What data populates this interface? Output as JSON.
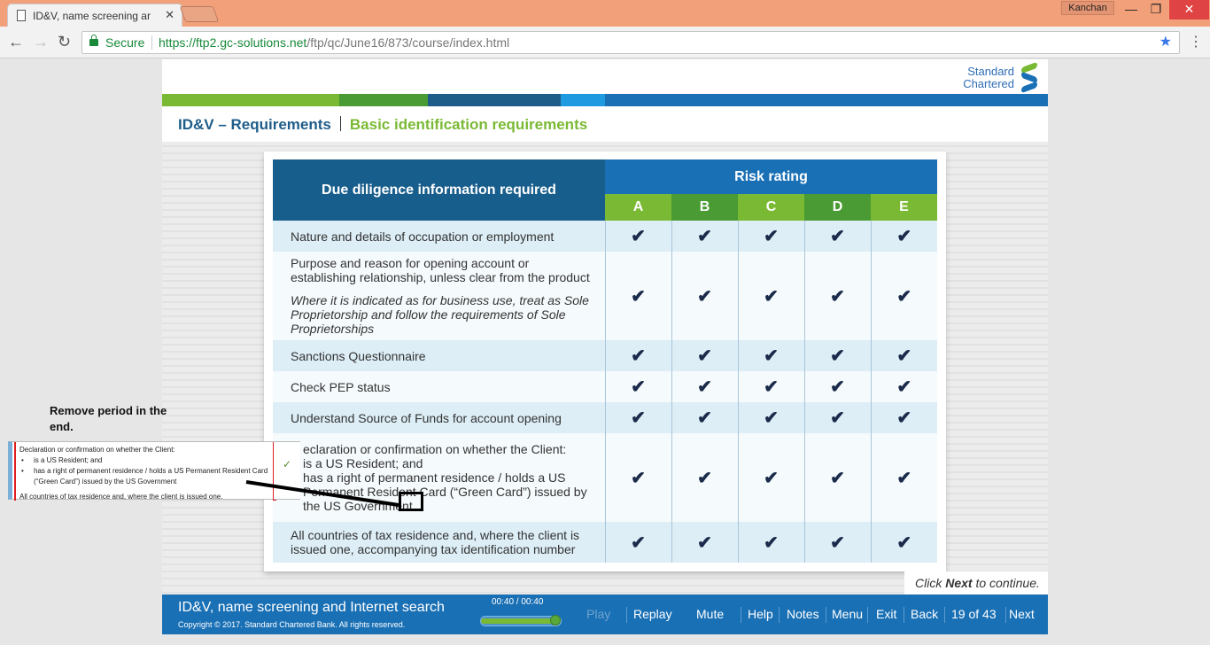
{
  "browser": {
    "tab_title": "ID&V, name screening ar",
    "user": "Kanchan",
    "secure_label": "Secure",
    "url_host": "https://ftp2.gc-solutions.net",
    "url_path": "/ftp/qc/June16/873/course/index.html"
  },
  "logo": {
    "line1": "Standard",
    "line2": "Chartered"
  },
  "breadcrumb": {
    "section": "ID&V – Requirements",
    "page": "Basic identification requirements"
  },
  "table": {
    "left_header": "Due diligence information required",
    "risk_header": "Risk rating",
    "ratings": [
      "A",
      "B",
      "C",
      "D",
      "E"
    ],
    "check": "✔",
    "rows": [
      {
        "text": "Nature and details of occupation or employment"
      },
      {
        "text": "Purpose and reason for opening account or establishing relationship, unless clear from the product",
        "note": "Where it is indicated as for business use, treat as Sole Proprietorship and follow the requirements of Sole Proprietorships"
      },
      {
        "text": "Sanctions Questionnaire"
      },
      {
        "text": "Check PEP status"
      },
      {
        "text": "Understand Source of Funds for account opening"
      },
      {
        "text": "eclaration or confirmation on whether the Client:",
        "l2": "is a US Resident; and",
        "l3": "has a right of permanent residence / holds a US Permanent Resident Card (“Green Card”) issued by the US Government."
      },
      {
        "text": "All countries of tax residence and, where the client is issued one, accompanying tax identification number"
      }
    ]
  },
  "click_next": {
    "pre": "Click ",
    "bold": "Next",
    "post": " to continue."
  },
  "footer": {
    "title": "ID&V, name screening and Internet search",
    "copyright": "Copyright © 2017. Standard Chartered Bank. All rights reserved.",
    "time": "00:40 / 00:40",
    "progress": 1.0,
    "play": "Play",
    "replay": "Replay",
    "mute": "Mute",
    "help": "Help",
    "notes": "Notes",
    "menu": "Menu",
    "exit": "Exit",
    "back": "Back",
    "page": "19 of 43",
    "next": "Next"
  },
  "annotation": {
    "comment": "Remove period in the end.",
    "snippet_title": "Declaration or confirmation on whether  the Client:",
    "snippet_b1": "is a US Resident; and",
    "snippet_b2": "has a right of permanent residence / holds a US Permanent Resident Card (“Green Card”) issued by the US Government",
    "snippet_last": "All countries of tax residence and, where the client is issued one.",
    "snippet_check": "✓"
  }
}
